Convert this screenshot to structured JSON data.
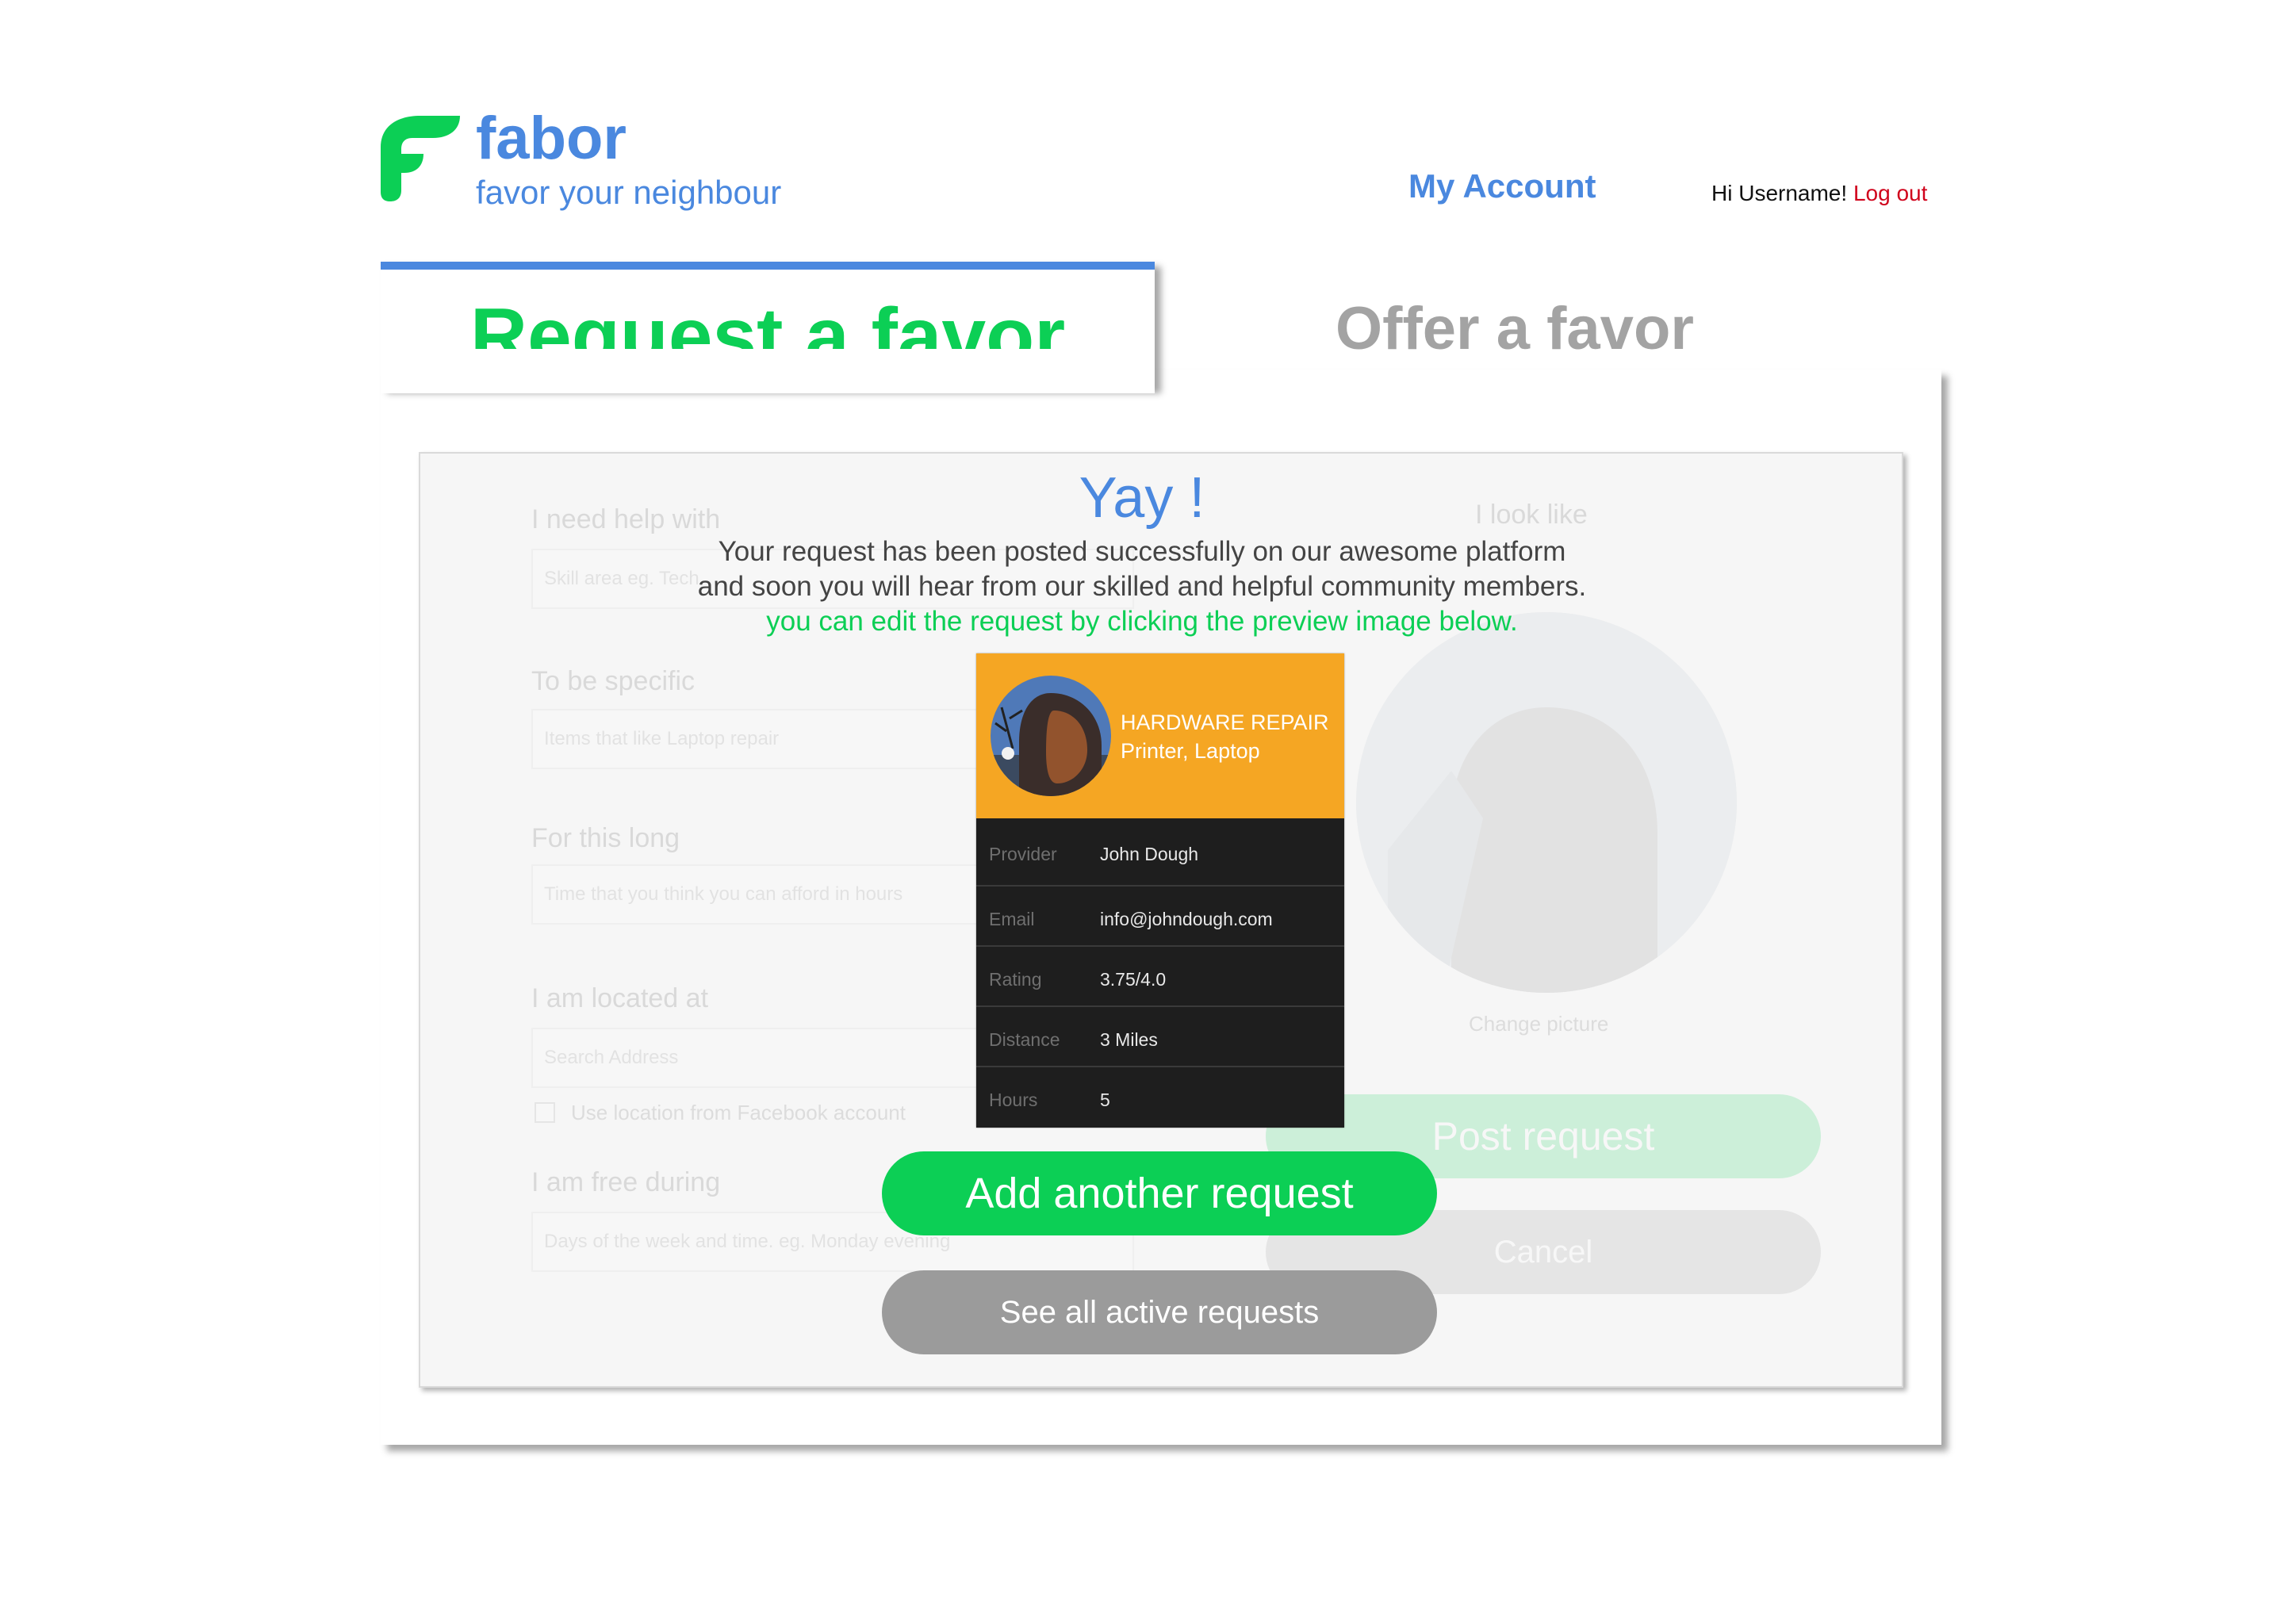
{
  "header": {
    "brand_name": "fabor",
    "tagline": "favor your neighbour",
    "my_account": "My Account",
    "greeting": "Hi Username!",
    "logout": "Log out"
  },
  "tabs": {
    "request": "Request a favor",
    "offer": "Offer a favor"
  },
  "form": {
    "help_label": "I need help with",
    "help_placeholder": "Skill area eg. Tech",
    "specific_label": "To be specific",
    "specific_placeholder": "Items that like Laptop repair",
    "duration_label": "For this long",
    "duration_placeholder": "Time that you think you can afford in hours",
    "location_label": "I am located at",
    "location_placeholder": "Search Address",
    "use_facebook_location": "Use location from Facebook account",
    "free_label": "I am free during",
    "free_placeholder": "Days of the week and time. eg. Monday evening",
    "look_like_label": "I look like",
    "change_picture": "Change picture",
    "post_request": "Post request",
    "cancel": "Cancel"
  },
  "success": {
    "title": "Yay !",
    "line1": "Your request has been posted successfully on our awesome platform",
    "line2": "and soon you will hear from our skilled and helpful community members.",
    "line3": "you can edit the request by clicking the preview image below."
  },
  "preview": {
    "category": "HARDWARE REPAIR",
    "items": "Printer, Laptop",
    "rows": [
      {
        "key": "Provider",
        "value": "John Dough"
      },
      {
        "key": "Email",
        "value": "info@johndough.com"
      },
      {
        "key": "Rating",
        "value": "3.75/4.0"
      },
      {
        "key": "Distance",
        "value": "3 Miles"
      },
      {
        "key": "Hours",
        "value": "5"
      }
    ]
  },
  "actions": {
    "add_another": "Add another request",
    "see_active": "See all active requests"
  },
  "colors": {
    "brand_blue": "#4a88df",
    "green": "#0ccf55",
    "orange": "#f5a623",
    "gray_button": "#9b9b9b",
    "logout_red": "#d0021b"
  }
}
